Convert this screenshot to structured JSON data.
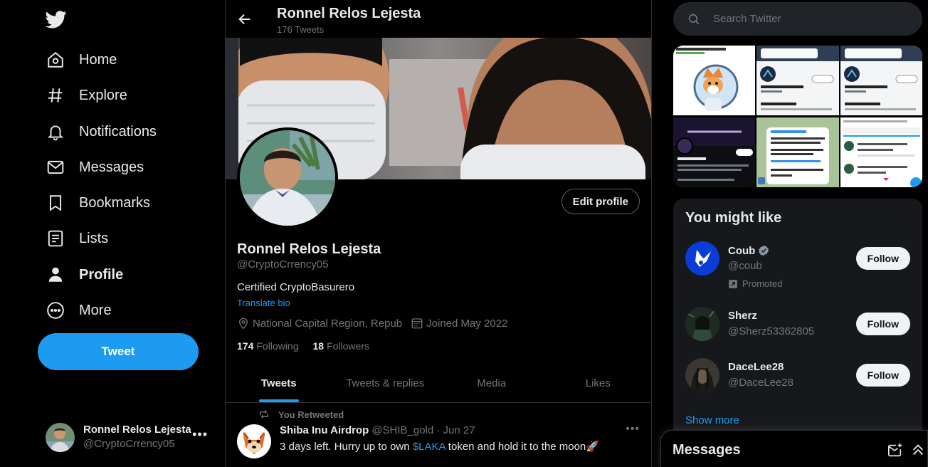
{
  "nav": {
    "items": [
      {
        "label": "Home",
        "icon": "home-icon"
      },
      {
        "label": "Explore",
        "icon": "hashtag-icon"
      },
      {
        "label": "Notifications",
        "icon": "bell-icon"
      },
      {
        "label": "Messages",
        "icon": "envelope-icon"
      },
      {
        "label": "Bookmarks",
        "icon": "bookmark-icon"
      },
      {
        "label": "Lists",
        "icon": "list-icon"
      },
      {
        "label": "Profile",
        "icon": "person-icon",
        "active": true
      },
      {
        "label": "More",
        "icon": "more-circle-icon"
      }
    ],
    "tweet_button": "Tweet",
    "account": {
      "name": "Ronnel Relos Lejesta",
      "handle": "@CryptoCrrency05"
    }
  },
  "header": {
    "title": "Ronnel Relos Lejesta",
    "count": "176 Tweets"
  },
  "profile": {
    "name": "Ronnel Relos Lejesta",
    "handle": "@CryptoCrrency05",
    "bio": "Certified CryptoBasurero",
    "translate": "Translate bio",
    "location": "National Capital Region, Repub",
    "joined": "Joined May 2022",
    "following_count": "174",
    "following_label": "Following",
    "followers_count": "18",
    "followers_label": "Followers",
    "edit_button": "Edit profile"
  },
  "tabs": [
    {
      "label": "Tweets",
      "active": true
    },
    {
      "label": "Tweets & replies"
    },
    {
      "label": "Media"
    },
    {
      "label": "Likes"
    }
  ],
  "tweet": {
    "retweet_label": "You Retweeted",
    "author": "Shiba Inu Airdrop",
    "meta": "@SHIB_gold · Jun 27",
    "text_before": "3 days left. Hurry up to own ",
    "cashtag": "$LAKA",
    "text_after": " token and hold it to the moon🚀"
  },
  "search": {
    "placeholder": "Search Twitter"
  },
  "who_to_follow": {
    "title": "You might like",
    "items": [
      {
        "name": "Coub",
        "handle": "@coub",
        "verified": true,
        "promoted": "Promoted",
        "button": "Follow"
      },
      {
        "name": "Sherz",
        "handle": "@Sherz53362805",
        "button": "Follow"
      },
      {
        "name": "DaceLee28",
        "handle": "@DaceLee28",
        "button": "Follow"
      }
    ],
    "show_more": "Show more"
  },
  "messages_drawer": {
    "title": "Messages"
  },
  "colors": {
    "accent": "#1d9bf0",
    "background": "#000000",
    "muted": "#71767b",
    "text": "#e7e9ea"
  }
}
